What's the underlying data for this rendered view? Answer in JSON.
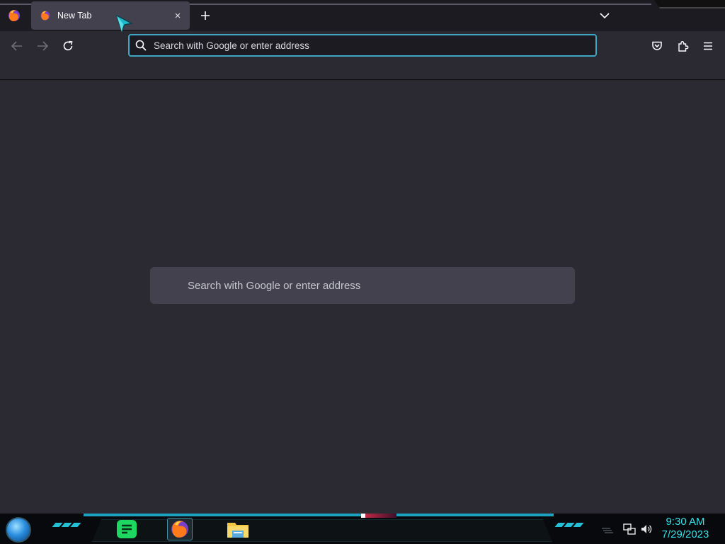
{
  "browser": {
    "tab": {
      "title": "New Tab",
      "close_glyph": "×"
    },
    "new_tab_glyph": "+",
    "urlbar": {
      "placeholder": "Search with Google or enter address",
      "value": ""
    },
    "content_search": {
      "placeholder": "Search with Google or enter address"
    },
    "accent_color": "#3fa7c4",
    "icons": [
      "firefox-icon",
      "back-arrow-icon",
      "forward-arrow-icon",
      "reload-icon",
      "search-icon",
      "pocket-icon",
      "extensions-icon",
      "hamburger-menu-icon",
      "chevron-down-icon"
    ]
  },
  "taskbar": {
    "apps": [
      "notes-app-icon",
      "firefox-icon",
      "file-explorer-icon"
    ],
    "clock": {
      "time": "9:30 AM",
      "date": "7/29/2023"
    },
    "accent_color": "#1aa2bf",
    "clock_color": "#37e0e6"
  }
}
